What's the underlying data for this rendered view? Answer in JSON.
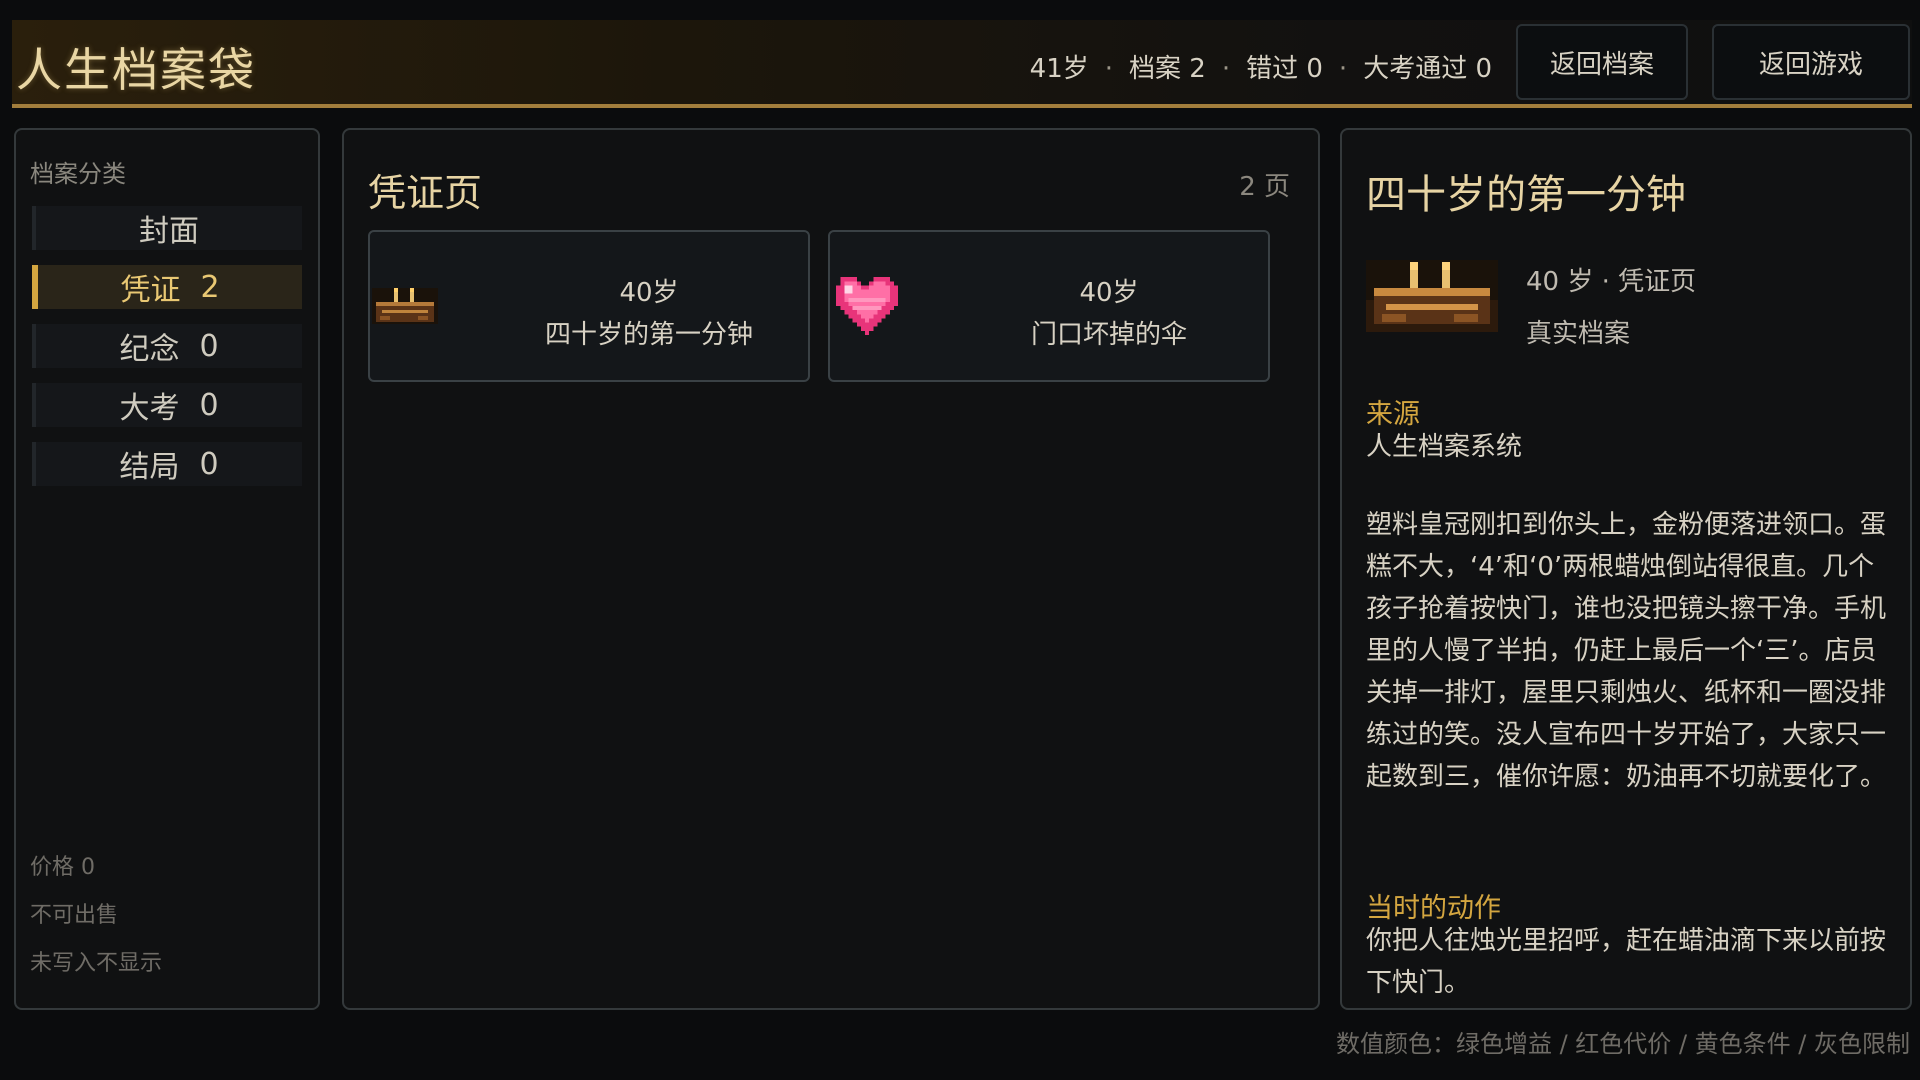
{
  "header": {
    "title": "人生档案袋",
    "stats": [
      "41岁",
      "档案 2",
      "错过 0",
      "大考通过 0"
    ],
    "separator": "·",
    "back_to_archive": "返回档案",
    "back_to_game": "返回游戏"
  },
  "sidebar": {
    "title": "档案分类",
    "items": [
      {
        "label": "封面",
        "count": ""
      },
      {
        "label": "凭证",
        "count": "2",
        "active": true
      },
      {
        "label": "纪念",
        "count": "0"
      },
      {
        "label": "大考",
        "count": "0"
      },
      {
        "label": "结局",
        "count": "0"
      }
    ],
    "notes": [
      "价格 0",
      "不可出售",
      "未写入不显示"
    ]
  },
  "list": {
    "title": "凭证页",
    "count": "2 页",
    "cards": [
      {
        "age": "40岁",
        "name": "四十岁的第一分钟",
        "icon": "birthday-cake-icon"
      },
      {
        "age": "40岁",
        "name": "门口坏掉的伞",
        "icon": "heart-icon"
      }
    ]
  },
  "detail": {
    "title": "四十岁的第一分钟",
    "meta_line1": "40 岁 · 凭证页",
    "meta_line2": "真实档案",
    "source_label": "来源",
    "source_text": "人生档案系统",
    "story": "塑料皇冠刚扣到你头上，金粉便落进领口。蛋糕不大，‘4’和‘0’两根蜡烛倒站得很直。几个孩子抢着按快门，谁也没把镜头擦干净。手机里的人慢了半拍，仍赶上最后一个‘三’。店员关掉一排灯，屋里只剩烛火、纸杯和一圈没排练过的笑。没人宣布四十岁开始了，大家只一起数到三，催你许愿：奶油再不切就要化了。",
    "action_label": "当时的动作",
    "action_text": "你把人往烛光里招呼，赶在蜡油滴下来以前按下快门。"
  },
  "footer": {
    "legend": "数值颜色：绿色增益 / 红色代价 / 黄色条件 / 灰色限制"
  },
  "colors": {
    "accent_gold": "#d4a640",
    "title_gold": "#e7d4a4",
    "background": "#0b0c0d",
    "panel": "#101112"
  }
}
